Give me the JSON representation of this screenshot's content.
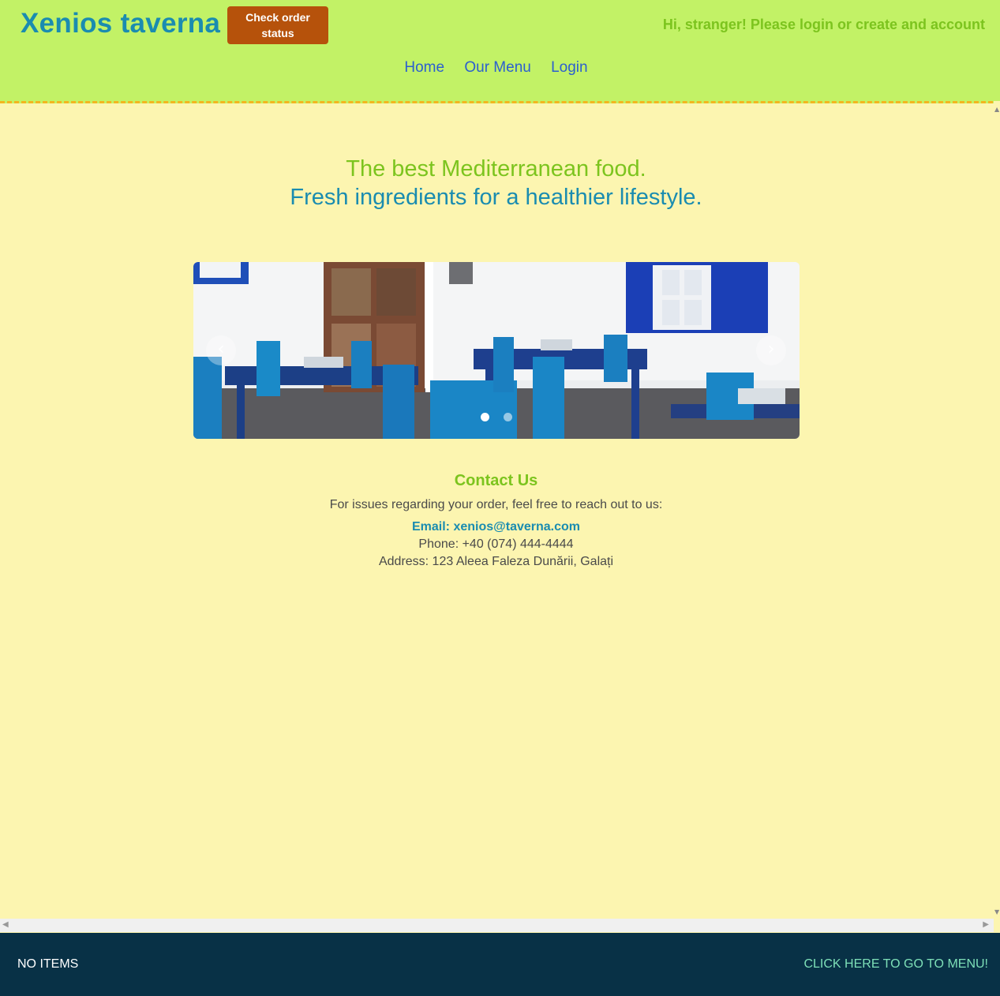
{
  "header": {
    "brand": "Xenios taverna",
    "order_button": "Check order status",
    "greeting": "Hi, stranger! Please login or create and account",
    "nav": [
      "Home",
      "Our Menu",
      "Login"
    ]
  },
  "hero": {
    "line1": "The best Mediterranean food.",
    "line2": "Fresh ingredients for a healthier lifestyle."
  },
  "carousel": {
    "slide_count": 2,
    "active_slide": 1,
    "prev_icon": "chevron-left",
    "next_icon": "chevron-right"
  },
  "contact": {
    "title": "Contact Us",
    "intro": "For issues regarding your order, feel free to reach out to us:",
    "email": "Email: xenios@taverna.com",
    "phone": "Phone: +40 (074) 444-4444",
    "address": "Address: 123 Aleea Faleza Dunării, Galați"
  },
  "footer": {
    "cart_status": "NO ITEMS",
    "menu_link": "CLICK HERE TO GO TO MENU!"
  },
  "colors": {
    "header_bg": "#c2f266",
    "page_bg": "#fcf5b0",
    "brand": "#1a8cb0",
    "accent_green": "#7cc41e",
    "order_button": "#b6520b",
    "footer_bg": "#083146"
  }
}
